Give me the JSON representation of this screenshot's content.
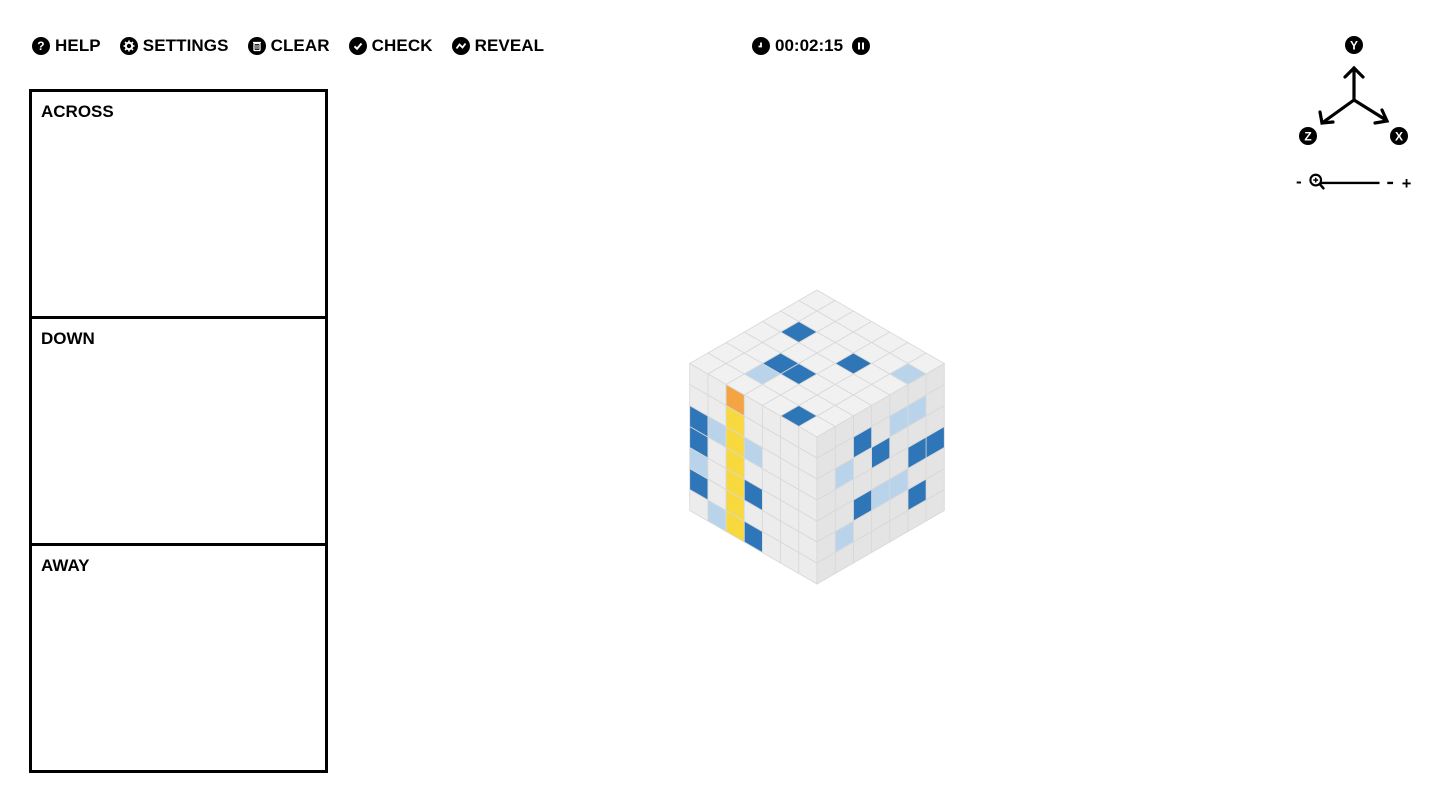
{
  "toolbar": {
    "help": {
      "label": "HELP",
      "icon": "question-icon"
    },
    "settings": {
      "label": "SETTINGS",
      "icon": "gear-icon"
    },
    "clear": {
      "label": "CLEAR",
      "icon": "trash-icon"
    },
    "check": {
      "label": "CHECK",
      "icon": "check-icon"
    },
    "reveal": {
      "label": "REVEAL",
      "icon": "reveal-icon"
    }
  },
  "timer": {
    "value": "00:02:15",
    "icon": "clock-icon",
    "pause_icon": "pause-icon"
  },
  "clues": {
    "across": {
      "title": "ACROSS",
      "items": []
    },
    "down": {
      "title": "DOWN",
      "items": []
    },
    "away": {
      "title": "AWAY",
      "items": []
    }
  },
  "axes": {
    "y": "Y",
    "z": "Z",
    "x": "X"
  },
  "zoom": {
    "minus": "-",
    "plus": "+",
    "icon": "zoom-icon"
  },
  "colors": {
    "filled": "#2f76b8",
    "filled_light": "#b9d4ea",
    "active_cell": "#f4a443",
    "active_word": "#f7d93e",
    "empty": "#f1f1f1"
  }
}
